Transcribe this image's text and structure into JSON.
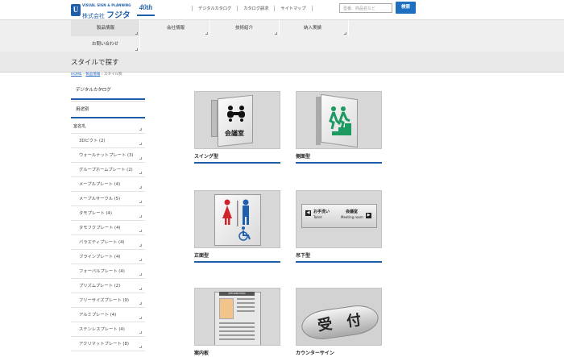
{
  "header": {
    "logo_top": "VISUAL SIGN & PLANNING",
    "logo_prefix": "株式会社",
    "logo_name": "フジタ",
    "logo_mark": "U",
    "logo_anniversary": "40th",
    "links": [
      "デジタルカタログ",
      "カタログ請求",
      "サイトマップ"
    ],
    "search_placeholder": "型番、商品名など",
    "search_button": "検索"
  },
  "nav": {
    "items": [
      "製品情報",
      "会社情報",
      "技術紹介",
      "納入実績",
      "お問い合わせ"
    ]
  },
  "page_title": "スタイルで探す",
  "breadcrumb": {
    "home": "HOME",
    "sep1": " › ",
    "products": "製品情報",
    "sep2": " › ",
    "current": "スタイル別"
  },
  "sidebar": {
    "digital_catalog": "デジタルカタログ",
    "by_use": "用途別",
    "category": "室名札",
    "items": [
      "3Dピクト (2)",
      "ウォールナットプレート (3)",
      "グループホームプレート (2)",
      "メープルプレート (4)",
      "メープルサークル (5)",
      "タモプレート (4)",
      "タモフクプレート (4)",
      "バラエティプレート (4)",
      "ブラインプレート (4)",
      "フォーバルプレート (4)",
      "プリズムプレート (2)",
      "フリーサイズプレート (9)",
      "アルミプレート (4)",
      "ステンレスプレート (4)",
      "アクリマットプレート (8)"
    ]
  },
  "products": [
    {
      "label": "スイング型",
      "sign_text": "会議室"
    },
    {
      "label": "側面型"
    },
    {
      "label": "正面型"
    },
    {
      "label": "吊下型",
      "sign_left_top": "お手洗い",
      "sign_left_bottom": "Toilet",
      "sign_right_top": "会議室",
      "sign_right_bottom": "Meeting room"
    },
    {
      "label": "案内板",
      "sign_text": "INFORMATION"
    },
    {
      "label": "カウンターサイン",
      "sign_text": "受 付"
    }
  ],
  "colors": {
    "brand": "#1f5fa8",
    "accent_button": "#1f6fc0",
    "green_pict": "#1d9a62",
    "red_pict": "#d0242c",
    "blue_pict": "#1f5fb0"
  }
}
